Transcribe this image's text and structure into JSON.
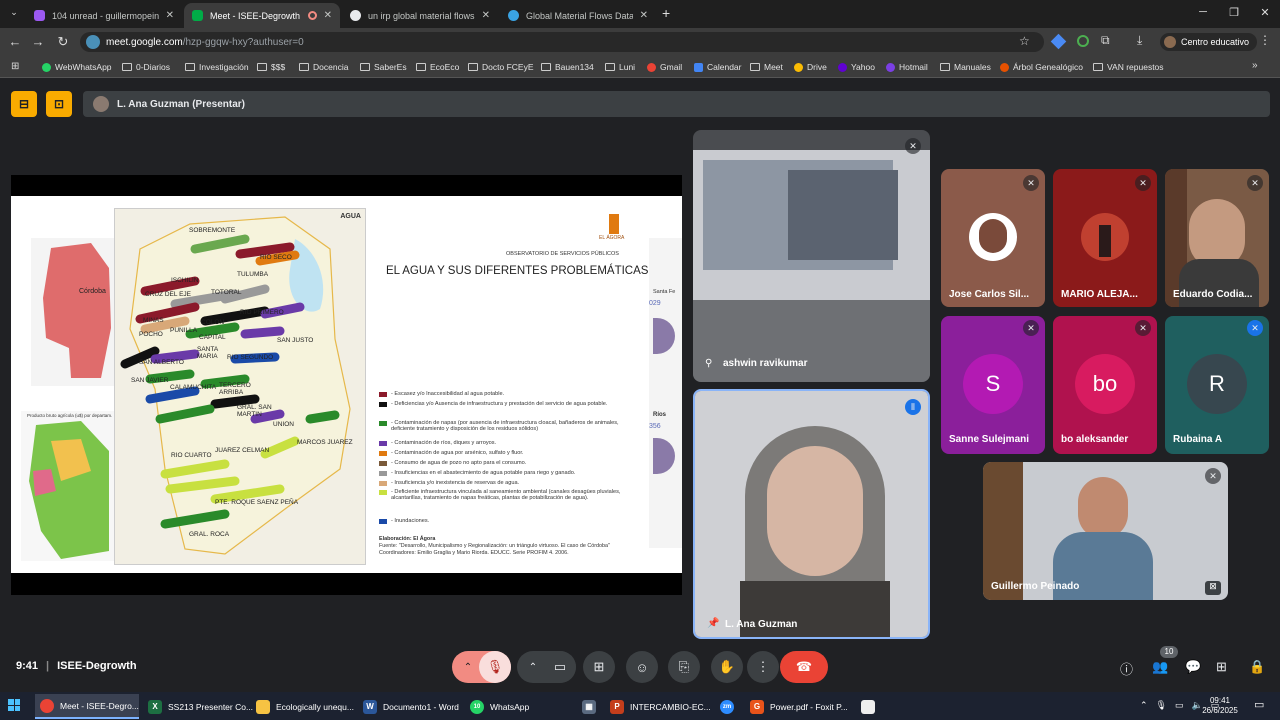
{
  "browser": {
    "tabs": [
      {
        "title": "104 unread - guillermopeinadoc",
        "fav_color": "#9b59f0"
      },
      {
        "title": "Meet - ISEE-Degrowth",
        "fav_color": "#00ac47"
      },
      {
        "title": "un irp global material flows da",
        "fav_color": "#e8eaed"
      },
      {
        "title": "Global Material Flows Database",
        "fav_color": "#3aa3e3"
      }
    ],
    "new_tab": "+",
    "url_host": "meet.google.com",
    "url_path": "/hzp-ggqw-hxy?authuser=0",
    "profile_label": "Centro educativo",
    "bookmarks": [
      "WebWhatsApp",
      "0-Diarios",
      "Investigación",
      "$$$",
      "Docencia",
      "SaberEs",
      "EcoEco",
      "Docto FCEyE",
      "Bauen134",
      "Luni",
      "Gmail",
      "Calendar",
      "Meet",
      "Drive",
      "Yahoo",
      "Hotmail",
      "Manuales",
      "Árbol Genealógico",
      "VAN repuestos"
    ]
  },
  "meet": {
    "presenter_bar": "L. Ana Guzman (Presentar)",
    "slide": {
      "map_title": "AGUA",
      "observatory": "OBSERVATORIO DE SERVICIOS PÚBLICOS",
      "heading": "EL AGUA Y SUS DIFERENTES PROBLEMÁTICAS",
      "logo": "EL ÁGORA",
      "left_label": "Córdoba",
      "chart_label": "Producto bruto agrícola (u$) por departam.",
      "side_a": "Santa Fe",
      "side_b": "Ríos",
      "side_n1": "029",
      "side_n2": "356",
      "places": [
        "SOBREMONTE",
        "RIO SECO",
        "ISCHILIN",
        "TULUMBA",
        "CRUZ DEL EJE",
        "TOTORAL",
        "MINAS",
        "COLON",
        "RIO PRIMERO",
        "POCHO",
        "PUNILLA",
        "CAPITAL",
        "SANTA MARIA",
        "RIO SEGUNDO",
        "SAN JUSTO",
        "SAN ALBERTO",
        "SAN JAVIER",
        "CALAMUCHITA",
        "TERCERO ARRIBA",
        "GRAL. SAN MARTIN",
        "UNION",
        "MARCOS JUAREZ",
        "RIO CUARTO",
        "JUAREZ CELMAN",
        "PTE. ROQUE SAENZ PEÑA",
        "GRAL. ROCA"
      ],
      "legend": [
        {
          "color": "#8b1a2b",
          "text": "- Escasez y/o Inaccesibilidad al agua potable."
        },
        {
          "color": "#111111",
          "text": "- Deficiencias y/o Ausencia de infraestructura y prestación del servicio de agua potable."
        },
        {
          "color": "#2a8a2a",
          "text": "- Contaminación de napas (por ausencia de infraestructura cloacal, bañaderos de animales, deficiente tratamiento y disposición de los residuos sólidos)"
        },
        {
          "color": "#6a3aa8",
          "text": "- Contaminación de ríos, diques y arroyos."
        },
        {
          "color": "#e07a10",
          "text": "- Contaminación de agua por arsénico, sulfato y fluor."
        },
        {
          "color": "#7a5a3a",
          "text": "- Consumo de agua de pozo no apto para el consumo."
        },
        {
          "color": "#999999",
          "text": "- Insuficiencias en el abastecimiento de agua potable para riego y ganado."
        },
        {
          "color": "#d8a878",
          "text": "- Insuficiencia y/o inexistencia de reservas de agua."
        },
        {
          "color": "#c8e040",
          "text": "- Deficiente infraestructura vinculada al saneamiento ambiental (canales desagües pluviales, alcantarillas, tratamiento de napas freáticas, plantas de potabilización de agua)."
        },
        {
          "color": "#1a4aa8",
          "text": "- Inundaciones."
        }
      ],
      "credit1": "Elaboración: El Ágora",
      "credit2": "Fuente: \"Desarrollo, Municipalismo y Regionalización: un triángulo virtuoso. El caso de Córdoba\"",
      "credit3": "Coordinadores: Emilio Graglia y Mario Riorda. EDUCC. Serie PROFIM 4. 2006."
    },
    "participants": [
      {
        "name": "ashwin ravikumar"
      },
      {
        "name": "L. Ana Guzman"
      },
      {
        "name": "Jose Carlos Sil..."
      },
      {
        "name": "MARIO ALEJA..."
      },
      {
        "name": "Eduardo Codia..."
      },
      {
        "name": "Sanne Sulejmani",
        "initial": "S",
        "color": "#b31ab3",
        "bg": "#8b1f9b"
      },
      {
        "name": "bo aleksander",
        "initial": "bo",
        "color": "#d81b60",
        "bg": "#b0124e"
      },
      {
        "name": "Rubaina A",
        "initial": "R",
        "color": "#37474f",
        "bg": "#1f5f5f"
      },
      {
        "name": "Guillermo Peinado"
      }
    ],
    "time": "9:41",
    "meeting_name": "ISEE-Degrowth",
    "people_count": "10"
  },
  "taskbar": {
    "items": [
      "Meet - ISEE-Degro...",
      "SS213 Presenter Co...",
      "Ecologically unequ...",
      "Documento1 - Word",
      "WhatsApp",
      "",
      "INTERCAMBIO-EC...",
      "",
      "Power.pdf - Foxit P..."
    ],
    "whatsapp_badge": "10",
    "clock_time": "09:41",
    "clock_date": "26/6/2025"
  }
}
